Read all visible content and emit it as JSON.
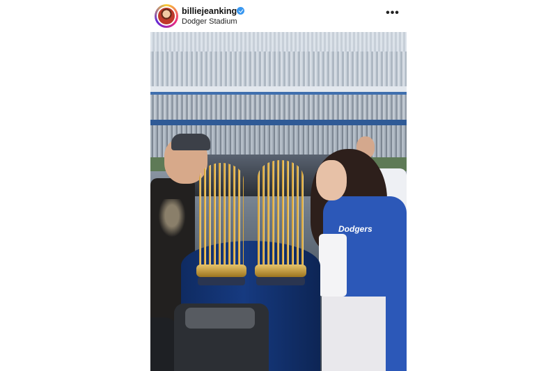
{
  "post": {
    "username": "billiejeanking",
    "verified": true,
    "location": "Dodger Stadium",
    "more_glyph": "•••"
  },
  "photo": {
    "jacket_text": "Dodgers"
  },
  "colors": {
    "verified_badge": "#3897f0",
    "dodger_blue": "#2c58b8"
  },
  "icons": [
    "verified-badge-icon",
    "more-options-icon"
  ]
}
